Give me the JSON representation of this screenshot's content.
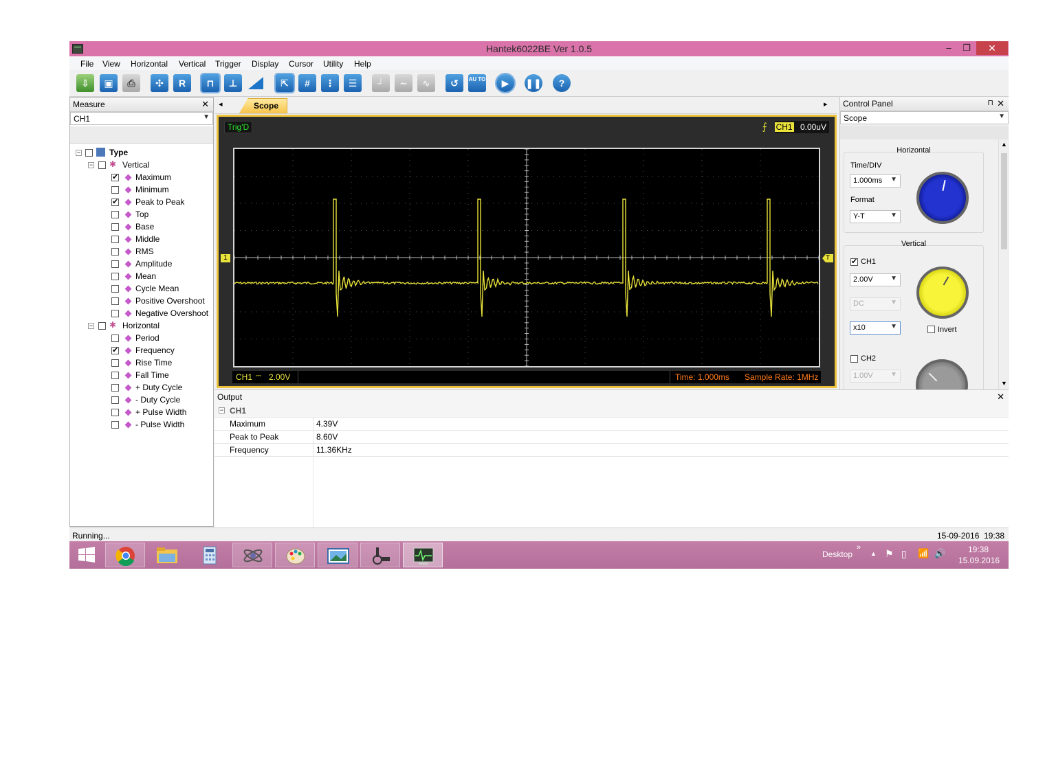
{
  "window": {
    "title": "Hantek6022BE Ver 1.0.5",
    "controls": {
      "minimize": "–",
      "restore": "❐",
      "close": "✕"
    }
  },
  "menu": [
    "File",
    "View",
    "Horizontal",
    "Vertical",
    "Trigger",
    "Display",
    "Cursor",
    "Utility",
    "Help"
  ],
  "toolbar": {
    "icons": [
      "open-icon",
      "save-icon",
      "print-icon",
      "zoom-fit-icon",
      "reference-icon",
      "pulse-wave-icon",
      "pulse-edge-icon",
      "ramp-icon",
      "cursor-select-icon",
      "grid-icon",
      "vertical-cursor-icon",
      "horizontal-cursor-icon",
      "step-icon",
      "smooth-wave-icon",
      "sine-icon",
      "refresh-icon",
      "auto-icon",
      "run-icon",
      "pause-icon",
      "help-icon"
    ],
    "auto_label": "AU TO",
    "reference_label": "R",
    "help_label": "?"
  },
  "measure": {
    "title": "Measure",
    "channel": "CH1",
    "tree": {
      "root": "Type",
      "vertical": {
        "label": "Vertical",
        "items": [
          {
            "label": "Maximum",
            "checked": true
          },
          {
            "label": "Minimum",
            "checked": false
          },
          {
            "label": "Peak to Peak",
            "checked": true
          },
          {
            "label": "Top",
            "checked": false
          },
          {
            "label": "Base",
            "checked": false
          },
          {
            "label": "Middle",
            "checked": false
          },
          {
            "label": "RMS",
            "checked": false
          },
          {
            "label": "Amplitude",
            "checked": false
          },
          {
            "label": "Mean",
            "checked": false
          },
          {
            "label": "Cycle Mean",
            "checked": false
          },
          {
            "label": "Positive Overshoot",
            "checked": false
          },
          {
            "label": "Negative Overshoot",
            "checked": false
          }
        ]
      },
      "horizontal": {
        "label": "Horizontal",
        "items": [
          {
            "label": "Period",
            "checked": false
          },
          {
            "label": "Frequency",
            "checked": true
          },
          {
            "label": "Rise Time",
            "checked": false
          },
          {
            "label": "Fall Time",
            "checked": false
          },
          {
            "label": "+ Duty Cycle",
            "checked": false
          },
          {
            "label": "- Duty Cycle",
            "checked": false
          },
          {
            "label": "+ Pulse Width",
            "checked": false
          },
          {
            "label": "- Pulse Width",
            "checked": false
          }
        ]
      }
    }
  },
  "scope": {
    "tab": "Scope",
    "status": "Trig'D",
    "trigger_channel": "CH1",
    "trigger_level": "0.00uV",
    "ch_marker": "1",
    "trig_marker": "T",
    "ch_label": "CH1",
    "ch_scale": "2.00V",
    "time": "Time: 1.000ms",
    "sample_rate": "Sample Rate: 1MHz",
    "trace_color": "#e8e23a"
  },
  "control_panel": {
    "title": "Control Panel",
    "mode": "Scope",
    "horizontal": {
      "caption": "Horizontal",
      "time_div_label": "Time/DIV",
      "time_div": "1.000ms",
      "format_label": "Format",
      "format": "Y-T",
      "knob_color": "#0a1fb8"
    },
    "vertical": {
      "caption": "Vertical",
      "ch1_label": "CH1",
      "ch1_enabled": true,
      "ch1_volts": "2.00V",
      "ch1_coupling": "DC",
      "ch1_probe": "x10",
      "invert_label": "Invert",
      "ch2_label": "CH2",
      "ch2_enabled": false,
      "ch2_volts": "1.00V",
      "ch1_knob_color": "#f2ee0a",
      "ch2_knob_color": "#8a8a8a"
    }
  },
  "output": {
    "title": "Output",
    "group": "CH1",
    "rows": [
      {
        "name": "Maximum",
        "value": "4.39V"
      },
      {
        "name": "Peak to Peak",
        "value": "8.60V"
      },
      {
        "name": "Frequency",
        "value": "11.36KHz"
      }
    ]
  },
  "status": {
    "left": "Running...",
    "right": "15-09-2016  19:38"
  },
  "taskbar": {
    "apps": [
      "windows-start-icon",
      "chrome-icon",
      "file-explorer-icon",
      "calculator-icon",
      "satellite-app-icon",
      "paint-icon",
      "photo-viewer-icon",
      "hardware-app-icon",
      "oscilloscope-app-icon"
    ],
    "desktop_label": "Desktop",
    "chevron": "»",
    "time": "19:38",
    "date": "15.09.2016"
  }
}
